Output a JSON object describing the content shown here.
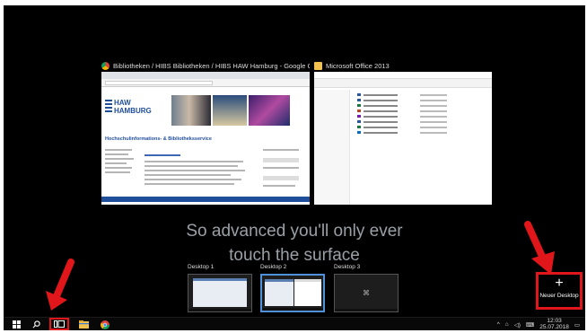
{
  "taskview": {
    "windows": [
      {
        "title": "Bibliotheken / HIBS Bibliotheken / HIBS HAW Hamburg - Google Chrome",
        "icon": "chrome-icon"
      },
      {
        "title": "Microsoft Office 2013",
        "icon": "folder-icon"
      }
    ],
    "haw": {
      "line1": "HAW",
      "line2": "HAMBURG",
      "heading": "Hochschulinformations- & Bibliotheksservice"
    },
    "tagline_line1": "So advanced you'll only ever",
    "tagline_line2": "touch the surface",
    "desktops": [
      {
        "label": "Desktop 1"
      },
      {
        "label": "Desktop 2"
      },
      {
        "label": "Desktop 3"
      }
    ],
    "new_desktop": {
      "symbol": "+",
      "label": "Neuer Desktop"
    }
  },
  "taskbar": {
    "icons": [
      "windows-start-icon",
      "search-icon",
      "task-view-icon",
      "file-explorer-icon",
      "chrome-icon"
    ],
    "time": "12:03",
    "date": "25.07.2018"
  },
  "colors": {
    "highlight": "#e0161b",
    "active_desktop": "#4f92d9",
    "haw_blue": "#1f4e9a"
  }
}
